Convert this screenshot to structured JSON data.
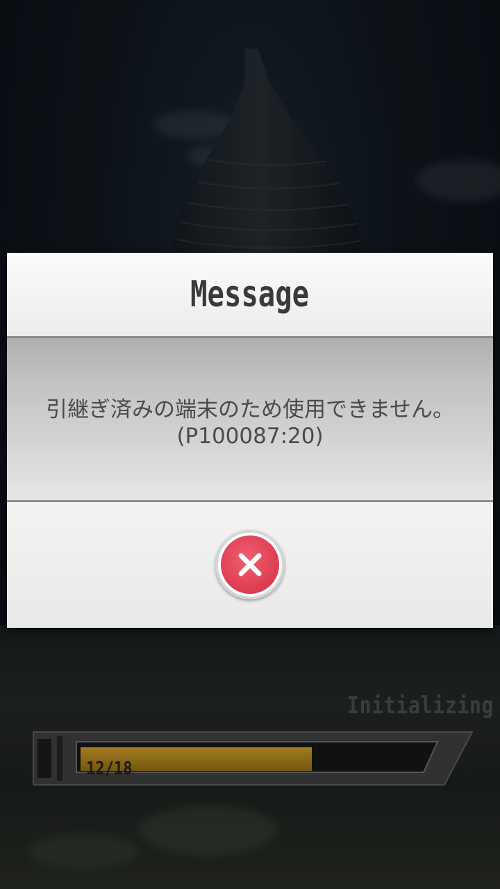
{
  "dialog": {
    "title": "Message",
    "message_line1": "引継ぎ済みの端末のため使用できません。",
    "message_line2": "(P100087:20)",
    "close_icon": "close-x-icon",
    "close_color": "#e04055"
  },
  "loading": {
    "status_text": "Initializing",
    "progress_text": "12/18",
    "progress_current": 12,
    "progress_total": 18,
    "bar_color": "#a67c1b"
  }
}
